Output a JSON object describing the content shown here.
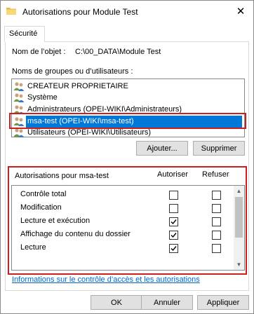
{
  "window": {
    "title": "Autorisations pour Module Test",
    "close_glyph": "✕"
  },
  "tabs": [
    {
      "label": "Sécurité"
    }
  ],
  "object": {
    "label": "Nom de l’objet :",
    "value": "C:\\00_DATA\\Module Test"
  },
  "groups": {
    "label": "Noms de groupes ou d’utilisateurs :",
    "items": [
      {
        "label": "CREATEUR PROPRIETAIRE",
        "selected": false
      },
      {
        "label": "Système",
        "selected": false
      },
      {
        "label": "Administrateurs (OPEI-WIKI\\Administrateurs)",
        "selected": false
      },
      {
        "label": "msa-test (OPEI-WIKI\\msa-test)",
        "selected": true
      },
      {
        "label": "Utilisateurs (OPEI-WIKI\\Utilisateurs)",
        "selected": false
      }
    ],
    "add_button": "Ajouter...",
    "remove_button": "Supprimer"
  },
  "permissions": {
    "label": "Autorisations pour msa-test",
    "allow_header": "Autoriser",
    "deny_header": "Refuser",
    "rows": [
      {
        "name": "Contrôle total",
        "allow": false,
        "deny": false
      },
      {
        "name": "Modification",
        "allow": false,
        "deny": false
      },
      {
        "name": "Lecture et exécution",
        "allow": true,
        "deny": false
      },
      {
        "name": "Affichage du contenu du dossier",
        "allow": true,
        "deny": false
      },
      {
        "name": "Lecture",
        "allow": true,
        "deny": false
      }
    ]
  },
  "info_link": "Informations sur le contrôle d’accès et les autorisations",
  "footer": {
    "ok": "OK",
    "cancel": "Annuler",
    "apply": "Appliquer"
  },
  "colors": {
    "selection": "#0078d7",
    "highlight_box": "#cc2020",
    "link": "#0066cc"
  }
}
